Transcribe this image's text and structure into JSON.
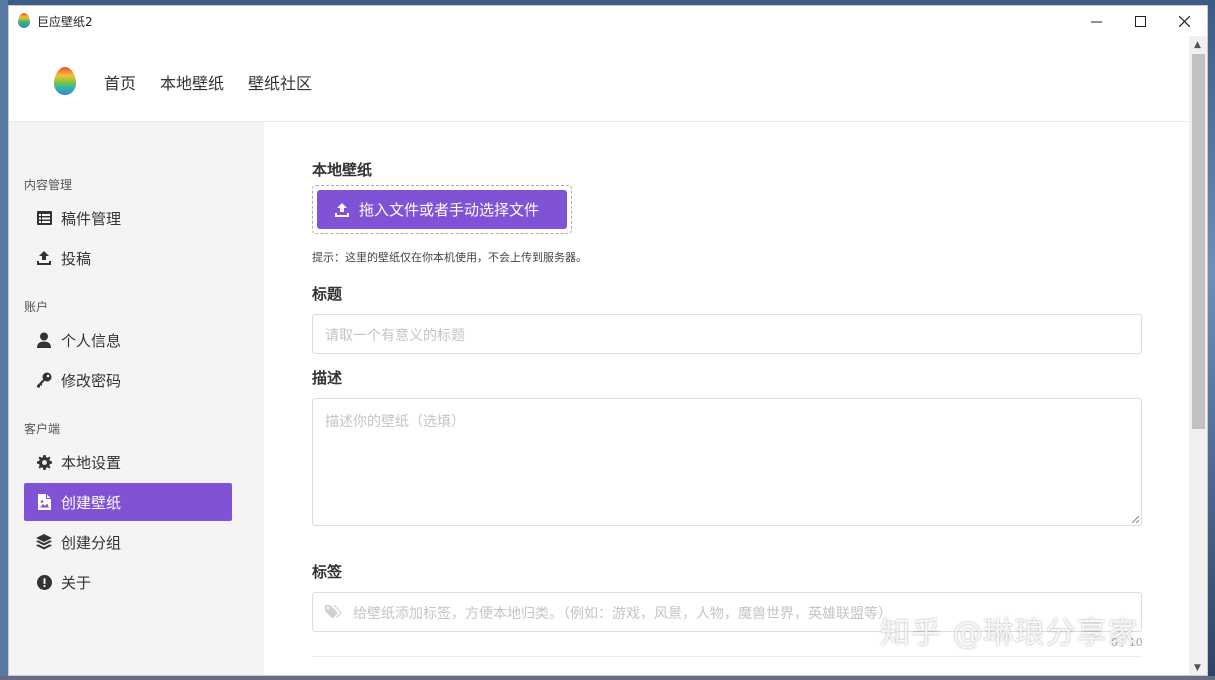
{
  "window": {
    "title": "巨应壁纸2",
    "controls": {
      "minimize": "—",
      "maximize": "☐",
      "close": "✕"
    }
  },
  "topnav": {
    "items": [
      {
        "label": "首页"
      },
      {
        "label": "本地壁纸"
      },
      {
        "label": "壁纸社区"
      }
    ]
  },
  "sidebar": {
    "sections": [
      {
        "label": "内容管理"
      },
      {
        "label": "账户"
      },
      {
        "label": "客户端"
      }
    ],
    "items": [
      {
        "label": "稿件管理",
        "icon": "list-icon"
      },
      {
        "label": "投稿",
        "icon": "upload-icon"
      },
      {
        "label": "个人信息",
        "icon": "user-icon"
      },
      {
        "label": "修改密码",
        "icon": "key-icon"
      },
      {
        "label": "本地设置",
        "icon": "gear-icon"
      },
      {
        "label": "创建壁纸",
        "icon": "image-file-icon",
        "active": true
      },
      {
        "label": "创建分组",
        "icon": "layers-icon"
      },
      {
        "label": "关于",
        "icon": "info-icon"
      }
    ]
  },
  "form": {
    "section_title": "本地壁纸",
    "upload_label": "拖入文件或者手动选择文件",
    "hint": "提示：这里的壁纸仅在你本机使用，不会上传到服务器。",
    "title_label": "标题",
    "title_placeholder": "请取一个有意义的标题",
    "title_value": "",
    "desc_label": "描述",
    "desc_placeholder": "描述你的壁纸（选填）",
    "desc_value": "",
    "tags_label": "标签",
    "tags_placeholder": "给壁纸添加标签，方便本地归类。（例如：游戏，风景，人物，魔兽世界，英雄联盟等）",
    "tags_value": ""
  },
  "overlay": {
    "watermark": "知乎 @琳琅分享家",
    "faint_text": "0 / 10"
  },
  "colors": {
    "accent": "#7f52d6",
    "sidebar_bg": "#f4f4f4"
  }
}
